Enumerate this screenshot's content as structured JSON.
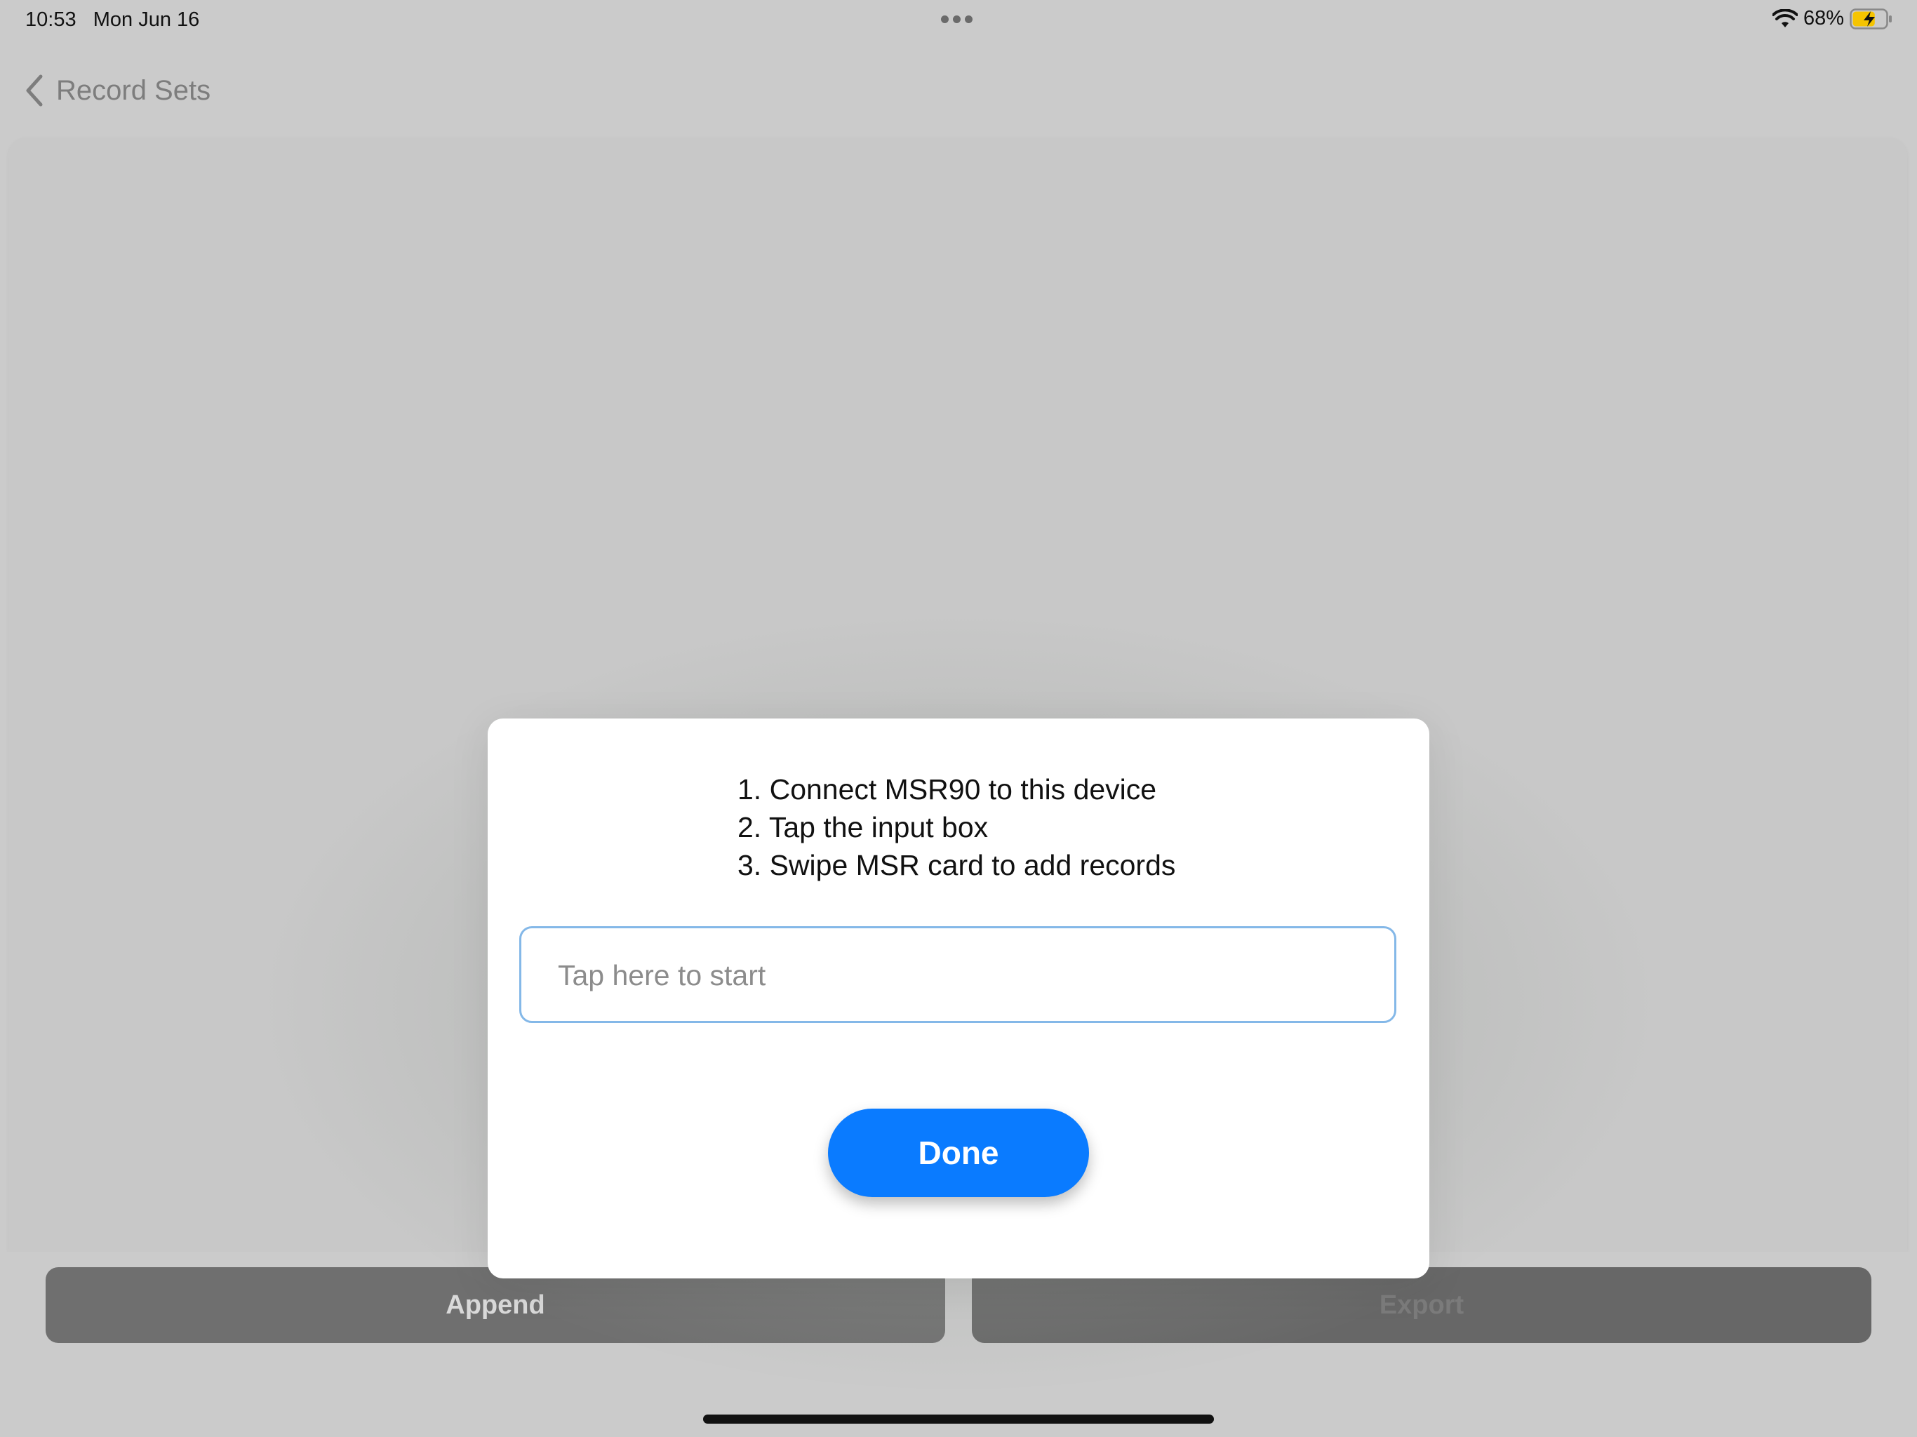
{
  "status_bar": {
    "time": "10:53",
    "date": "Mon Jun 16",
    "battery_percent": "68%",
    "battery_level": 0.68,
    "charging": true,
    "icons": [
      "wifi-icon",
      "battery-charging-icon",
      "more-dots-icon"
    ]
  },
  "nav": {
    "back_label": "Record Sets"
  },
  "dialog": {
    "instructions": [
      "1. Connect MSR90 to this device",
      "2. Tap the input box",
      "3. Swipe MSR card to add records"
    ],
    "input_placeholder": "Tap here to start",
    "input_value": "",
    "done_label": "Done"
  },
  "bottom_actions": {
    "append_label": "Append",
    "export_label": "Export"
  },
  "colors": {
    "accent": "#0a7bff",
    "input_border": "#84b8e8",
    "battery_fill": "#f5c400"
  }
}
